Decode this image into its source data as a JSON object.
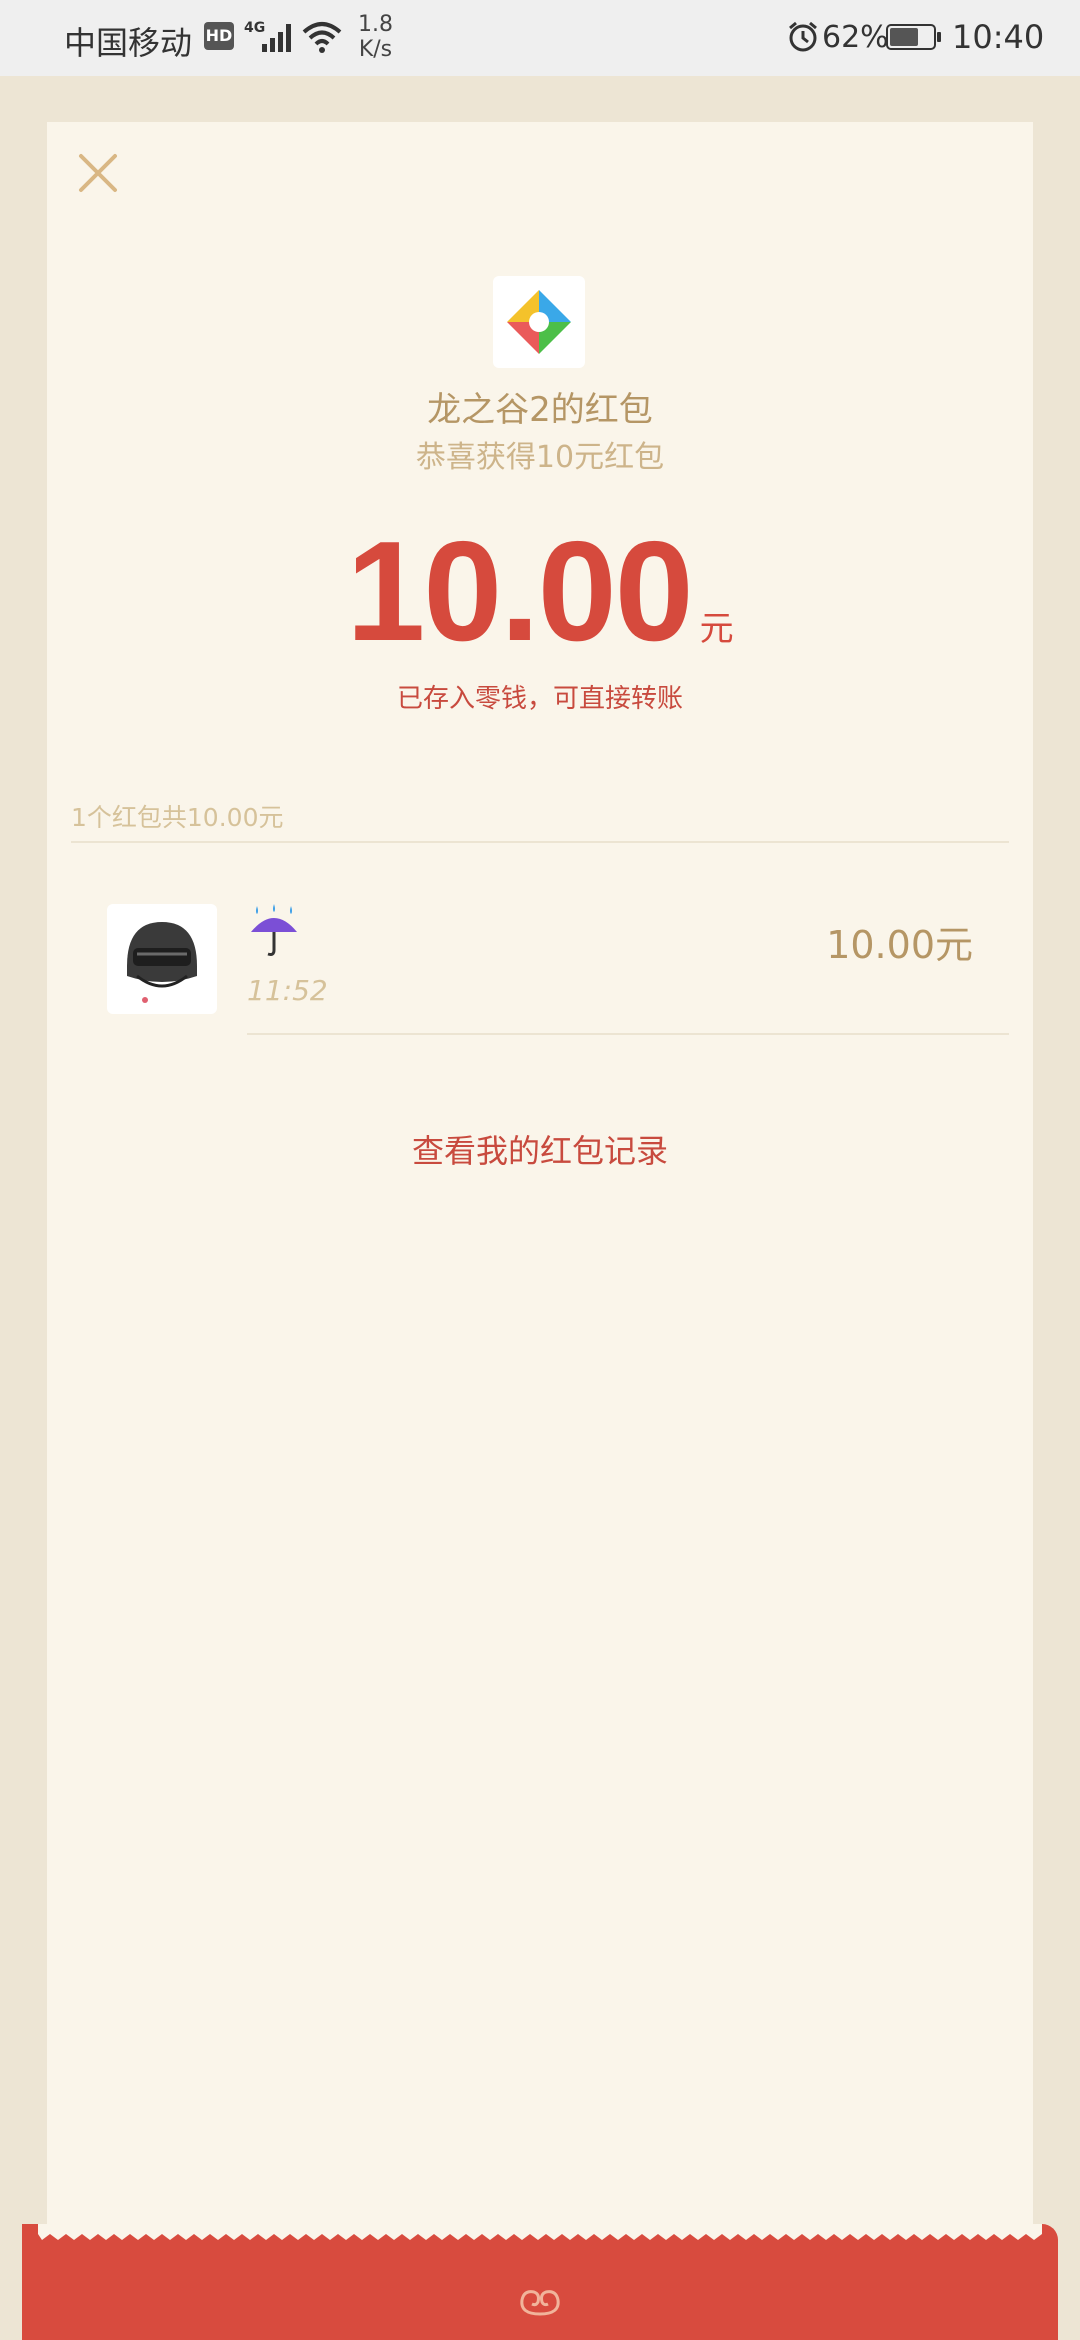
{
  "status_bar": {
    "carrier": "中国移动",
    "hd_badge": "HD",
    "net_type": "4G",
    "speed_value": "1.8",
    "speed_unit": "K/s",
    "battery_percent": "62%",
    "time": "10:40",
    "icons": [
      "hd-badge",
      "signal-icon",
      "wifi-icon",
      "alarm-icon",
      "battery-icon"
    ]
  },
  "card": {
    "close_icon": "close-icon",
    "logo_icon": "app-logo-icon",
    "sender_name": "龙之谷2的红包",
    "greeting": "恭喜获得10元红包",
    "amount": "10.00",
    "amount_unit": "元",
    "stored_note": "已存入零钱，可直接转账",
    "summary": "1个红包共10.00元",
    "records": [
      {
        "avatar_icon": "helmet-avatar-icon",
        "name_icon": "umbrella-rain-emoji-icon",
        "time": "11:52",
        "amount": "10.00元"
      }
    ],
    "history_link": "查看我的红包记录"
  },
  "colors": {
    "background": "#ede5d4",
    "card": "#faf5ea",
    "accent_red": "#d64a3d",
    "gold_text": "#b59665",
    "light_gold": "#d6c29a"
  }
}
